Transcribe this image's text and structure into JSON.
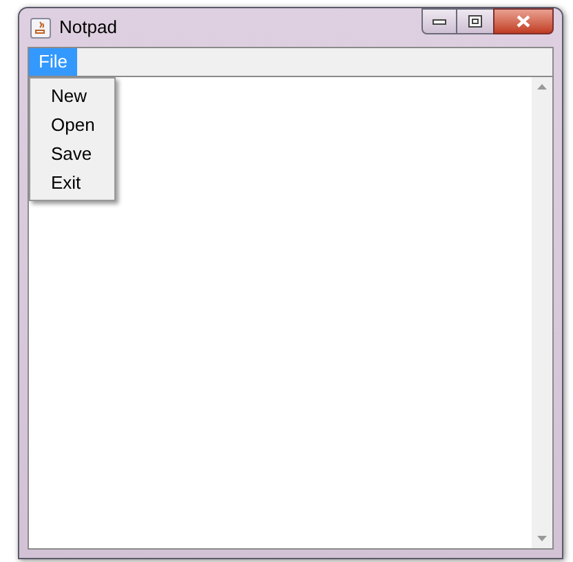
{
  "window": {
    "title": "Notpad"
  },
  "menu_bar": [
    {
      "label": "File",
      "selected": true
    }
  ],
  "menu": {
    "items": [
      {
        "label": "New"
      },
      {
        "label": "Open"
      },
      {
        "label": "Save"
      },
      {
        "label": "Exit"
      }
    ]
  }
}
